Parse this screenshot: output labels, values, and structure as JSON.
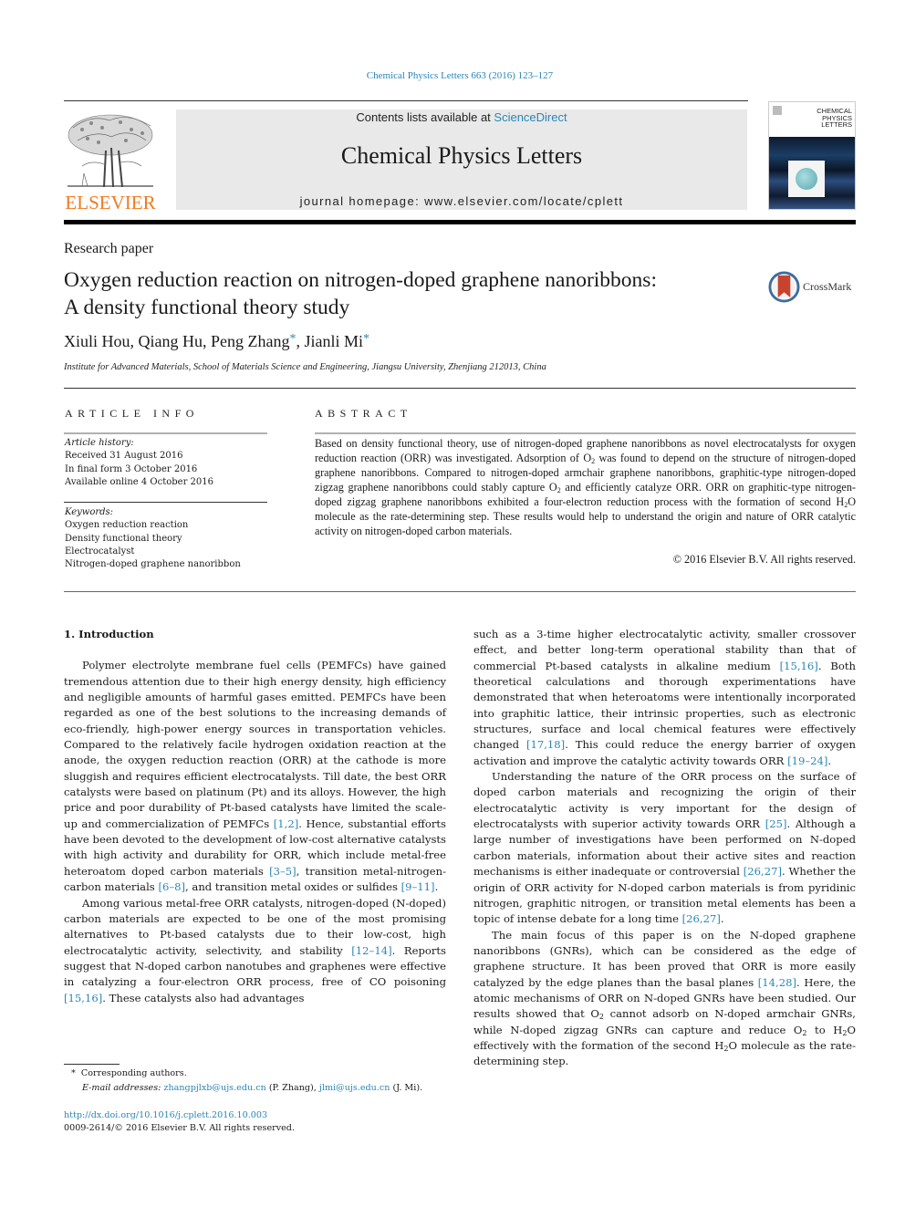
{
  "journal_ref": "Chemical Physics Letters 663 (2016) 123–127",
  "banner": {
    "contents_prefix": "Contents lists available at ",
    "contents_link": "ScienceDirect",
    "journal_title": "Chemical Physics Letters",
    "homepage_prefix": "journal homepage: ",
    "homepage_url": "www.elsevier.com/locate/cplett"
  },
  "publisher_logo": {
    "wordmark": "ELSEVIER",
    "color": "#f07a23"
  },
  "cover": {
    "title_lines": [
      "CHEMICAL",
      "PHYSICS",
      "LETTERS"
    ]
  },
  "article_type": "Research paper",
  "title_lines": [
    "Oxygen reduction reaction on nitrogen-doped graphene nanoribbons:",
    "A density functional theory study"
  ],
  "crossmark_label": "CrossMark",
  "authors": [
    {
      "name": "Xiuli Hou",
      "corresponding": false
    },
    {
      "name": "Qiang Hu",
      "corresponding": false
    },
    {
      "name": "Peng Zhang",
      "corresponding": true
    },
    {
      "name": "Jianli Mi",
      "corresponding": true
    }
  ],
  "authors_text": {
    "a1": "Xiuli Hou, Qiang Hu, Peng Zhang",
    "a2": ", Jianli Mi",
    "star": "*"
  },
  "affiliation": "Institute for Advanced Materials, School of Materials Science and Engineering, Jiangsu University, Zhenjiang 212013, China",
  "article_info": {
    "heading": "ARTICLE INFO",
    "history_label": "Article history:",
    "history": [
      "Received 31 August 2016",
      "In final form 3 October 2016",
      "Available online 4 October 2016"
    ],
    "keywords_label": "Keywords:",
    "keywords": [
      "Oxygen reduction reaction",
      "Density functional theory",
      "Electrocatalyst",
      "Nitrogen-doped graphene nanoribbon"
    ]
  },
  "abstract": {
    "heading": "ABSTRACT",
    "parts": {
      "p1": "Based on density functional theory, use of nitrogen-doped graphene nanoribbons as novel electrocatalysts for oxygen reduction reaction (ORR) was investigated. Adsorption of O",
      "p2": " was found to depend on the structure of nitrogen-doped graphene nanoribbons. Compared to nitrogen-doped armchair graphene nanoribbons, graphitic-type nitrogen-doped zigzag graphene nanoribbons could stably capture O",
      "p3": " and efficiently catalyze ORR. ORR on graphitic-type nitrogen-doped zigzag graphene nanoribbons exhibited a four-electron reduction process with the formation of second H",
      "p4": "O molecule as the rate-determining step. These results would help to understand the origin and nature of ORR catalytic activity on nitrogen-doped carbon materials.",
      "sub2": "2"
    },
    "copyright": "© 2016 Elsevier B.V. All rights reserved."
  },
  "body": {
    "section_heading": "1. Introduction",
    "left": {
      "p1": {
        "t1": "Polymer electrolyte membrane fuel cells (PEMFCs) have gained tremendous attention due to their high energy density, high efficiency and negligible amounts of harmful gases emitted. PEMFCs have been regarded as one of the best solutions to the increasing demands of eco-friendly, high-power energy sources in transportation vehicles. Compared to the relatively facile hydrogen oxidation reaction at the anode, the oxygen reduction reaction (ORR) at the cathode is more sluggish and requires efficient electrocatalysts. Till date, the best ORR catalysts were based on platinum (Pt) and its alloys. However, the high price and poor durability of Pt-based catalysts have limited the scale-up and commercialization of PEMFCs ",
        "r1": "[1,2]",
        "t2": ". Hence, substantial efforts have been devoted to the development of low-cost alternative catalysts with high activity and durability for ORR, which include metal-free heteroatom doped carbon materials ",
        "r2": "[3–5]",
        "t3": ", transition metal-nitrogen-carbon materials ",
        "r3": "[6–8]",
        "t4": ", and transition metal oxides or sulfides ",
        "r4": "[9–11]",
        "t5": "."
      },
      "p2": {
        "t1": "Among various metal-free ORR catalysts, nitrogen-doped (N-doped) carbon materials are expected to be one of the most promising alternatives to Pt-based catalysts due to their low-cost, high electrocatalytic activity, selectivity, and stability ",
        "r1": "[12–14]",
        "t2": ". Reports suggest that N-doped carbon nanotubes and graphenes were effective in catalyzing a four-electron ORR process, free of CO poisoning ",
        "r2": "[15,16]",
        "t3": ". These catalysts also had advantages"
      }
    },
    "right": {
      "p1": {
        "t1": "such as a 3-time higher electrocatalytic activity, smaller crossover effect, and better long-term operational stability than that of commercial Pt-based catalysts in alkaline medium ",
        "r1": "[15,16]",
        "t2": ". Both theoretical calculations and thorough experimentations have demonstrated that when heteroatoms were intentionally incorporated into graphitic lattice, their intrinsic properties, such as electronic structures, surface and local chemical features were effectively changed ",
        "r2": "[17,18]",
        "t3": ". This could reduce the energy barrier of oxygen activation and improve the catalytic activity towards ORR ",
        "r3": "[19–24]",
        "t4": "."
      },
      "p2": {
        "t1": "Understanding the nature of the ORR process on the surface of doped carbon materials and recognizing the origin of their electrocatalytic activity is very important for the design of electrocatalysts with superior activity towards ORR ",
        "r1": "[25]",
        "t2": ". Although a large number of investigations have been performed on N-doped carbon materials, information about their active sites and reaction mechanisms is either inadequate or controversial ",
        "r2": "[26,27]",
        "t3": ". Whether the origin of ORR activity for N-doped carbon materials is from pyridinic nitrogen, graphitic nitrogen, or transition metal elements has been a topic of intense debate for a long time ",
        "r3": "[26,27]",
        "t4": "."
      },
      "p3": {
        "t1": "The main focus of this paper is on the N-doped graphene nanoribbons (GNRs), which can be considered as the edge of graphene structure. It has been proved that ORR is more easily catalyzed by the edge planes than the basal planes ",
        "r1": "[14,28]",
        "t2": ". Here, the atomic mechanisms of ORR on N-doped GNRs have been studied. Our results showed that O",
        "t3": " cannot adsorb on N-doped armchair GNRs, while N-doped zigzag GNRs can capture and reduce O",
        "t4": " to H",
        "t5": "O effectively with the formation of the second H",
        "t6": "O molecule as the rate-determining step.",
        "sub2": "2"
      }
    }
  },
  "footnotes": {
    "star": "*",
    "corresponding": "Corresponding authors.",
    "email_label": "E-mail addresses: ",
    "email1": "zhangpjlxb@ujs.edu.cn",
    "email1_who": " (P. Zhang), ",
    "email2": "jlmi@ujs.edu.cn",
    "email2_who": " (J. Mi)."
  },
  "doi": "http://dx.doi.org/10.1016/j.cplett.2016.10.003",
  "issn_line": "0009-2614/© 2016 Elsevier B.V. All rights reserved.",
  "colors": {
    "link": "#2a86b5",
    "elsevier_orange": "#f07a23",
    "banner_bg": "#e9e9e9"
  }
}
